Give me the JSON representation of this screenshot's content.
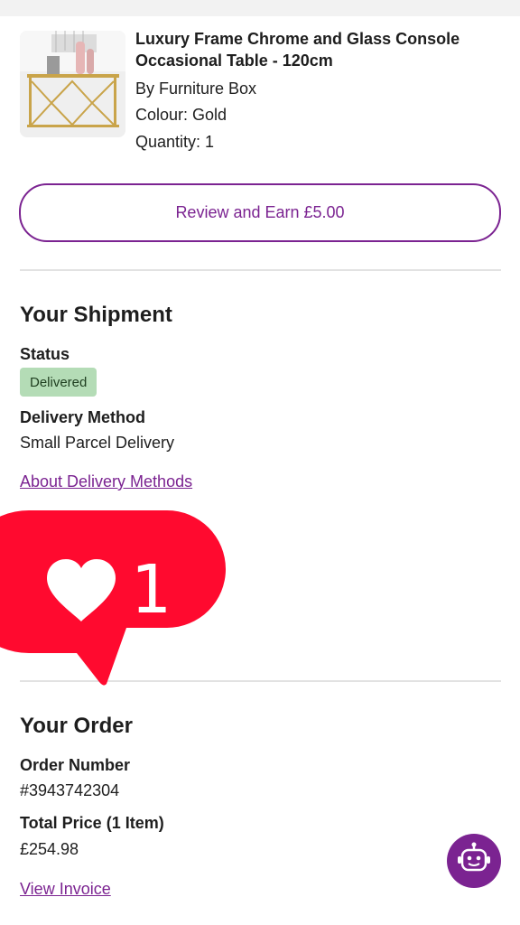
{
  "product": {
    "image_alt": "gold console table",
    "title": "Luxury Frame Chrome and Glass Console Occasional Table - 120cm",
    "brand": "By Furniture Box",
    "colour": "Colour: Gold",
    "quantity": "Quantity: 1"
  },
  "review_button": {
    "label": "Review and Earn £5.00"
  },
  "shipment": {
    "title": "Your Shipment",
    "status_label": "Status",
    "status_value": "Delivered",
    "method_label": "Delivery Method",
    "method_value": "Small Parcel Delivery",
    "about_link": "About Delivery Methods"
  },
  "like_overlay": {
    "icon": "heart-icon",
    "count": "1"
  },
  "order": {
    "title": "Your Order",
    "number_label": "Order Number",
    "number_value": "#3943742304",
    "total_label": "Total Price (1 Item)",
    "total_value": "£254.98",
    "invoice_link": "View Invoice"
  },
  "chat": {
    "icon": "chatbot-icon"
  },
  "colors": {
    "brand_purple": "#7b2391",
    "status_green": "#b4dcb6",
    "like_red": "#ff0a2f",
    "divider": "#e2e2e2"
  }
}
